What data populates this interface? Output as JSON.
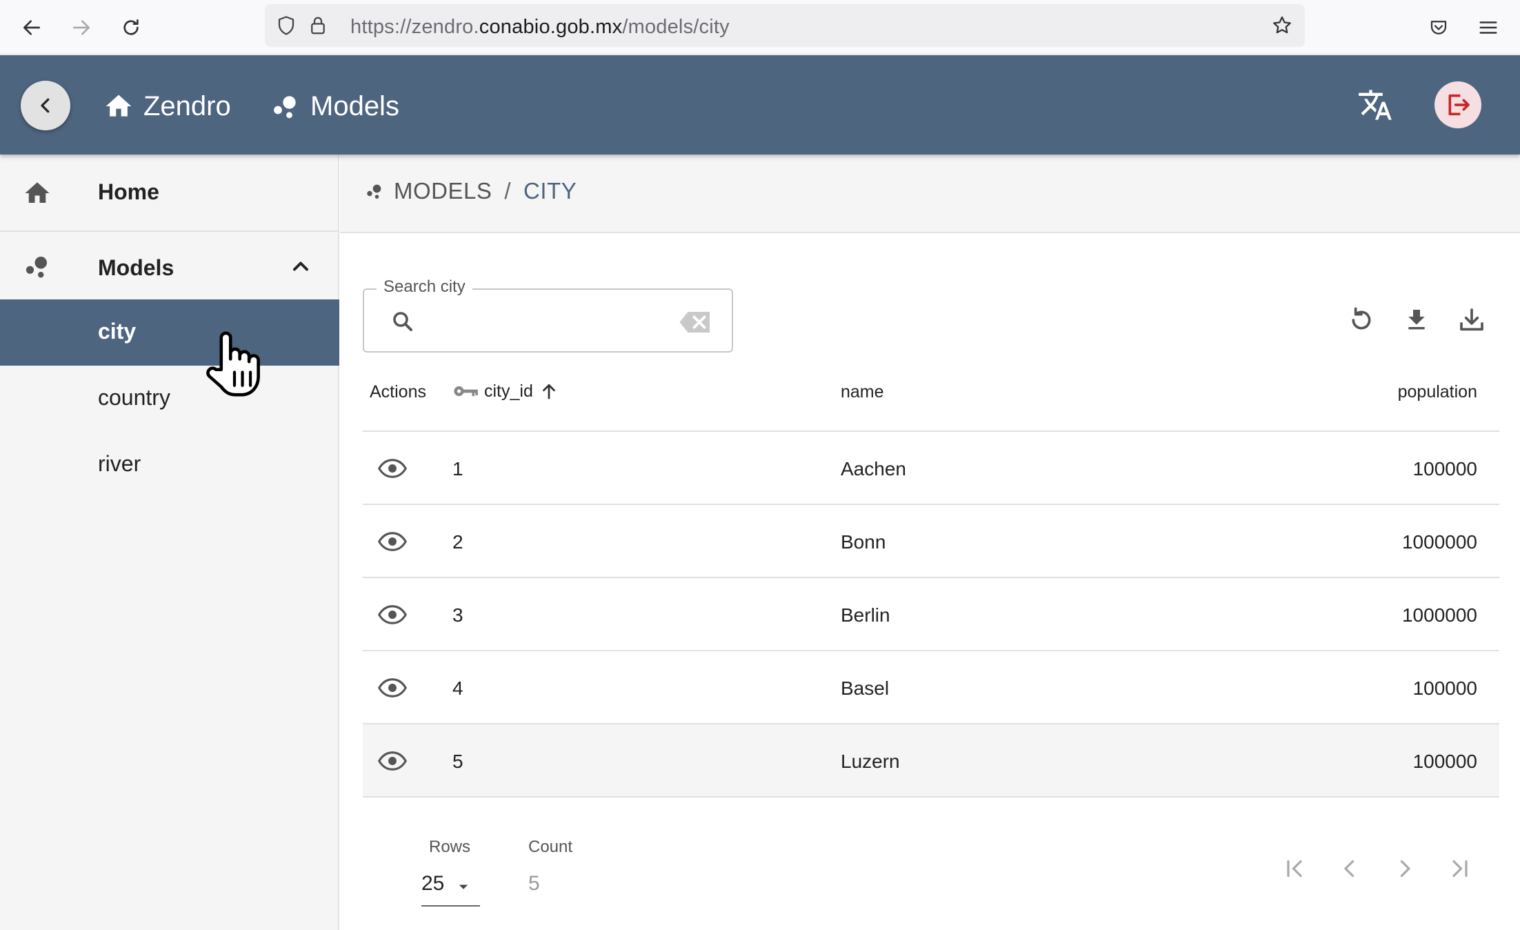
{
  "browser": {
    "url_prefix": "https://zendro.",
    "url_domain": "conabio.gob.mx",
    "url_path": "/models/city"
  },
  "header": {
    "home_label": "Zendro",
    "models_label": "Models"
  },
  "sidebar": {
    "home_label": "Home",
    "models_label": "Models",
    "items": [
      {
        "label": "city",
        "active": true
      },
      {
        "label": "country",
        "active": false
      },
      {
        "label": "river",
        "active": false
      }
    ]
  },
  "breadcrumb": {
    "root": "MODELS",
    "separator": "/",
    "current": "CITY"
  },
  "search": {
    "label": "Search city",
    "value": ""
  },
  "table": {
    "columns": {
      "actions": "Actions",
      "city_id": "city_id",
      "name": "name",
      "population": "population"
    },
    "rows": [
      {
        "city_id": "1",
        "name": "Aachen",
        "population": "100000"
      },
      {
        "city_id": "2",
        "name": "Bonn",
        "population": "1000000"
      },
      {
        "city_id": "3",
        "name": "Berlin",
        "population": "1000000"
      },
      {
        "city_id": "4",
        "name": "Basel",
        "population": "100000"
      },
      {
        "city_id": "5",
        "name": "Luzern",
        "population": "100000"
      }
    ]
  },
  "pagination": {
    "rows_label": "Rows",
    "rows_value": "25",
    "count_label": "Count",
    "count_value": "5"
  },
  "colors": {
    "header_bg": "#4e657f",
    "sidebar_active": "#4e657f",
    "logout_accent": "#c62828"
  }
}
